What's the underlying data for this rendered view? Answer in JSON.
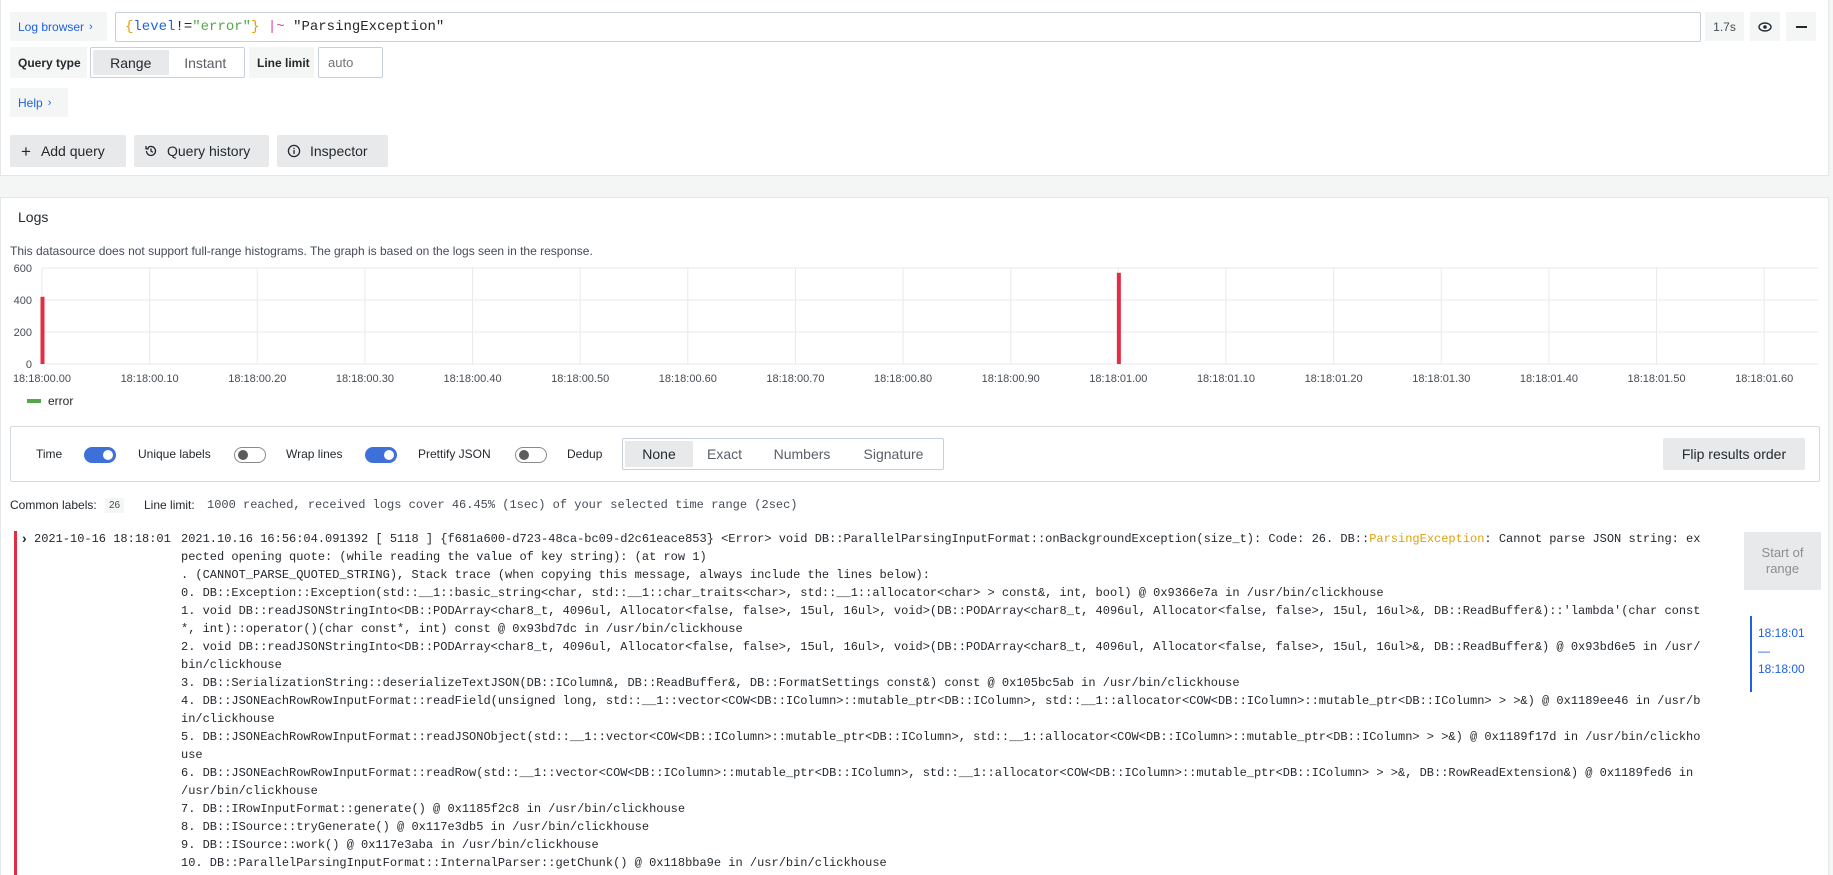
{
  "query_editor": {
    "log_browser_label": "Log browser",
    "query_parts": [
      {
        "text": "{",
        "color": "#e0a106"
      },
      {
        "text": "level",
        "color": "#1f62e0"
      },
      {
        "text": "!=",
        "color": "#24292e"
      },
      {
        "text": "\"error\"",
        "color": "#56a64b"
      },
      {
        "text": "}",
        "color": "#e0a106"
      },
      {
        "text": " |~ ",
        "color": "#d94ba6"
      },
      {
        "text": "\"ParsingException\"",
        "color": "#24292e"
      }
    ],
    "query_time": "1.7s",
    "query_type_label": "Query type",
    "query_type_options": [
      "Range",
      "Instant"
    ],
    "query_type_selected": "Range",
    "line_limit_label": "Line limit",
    "line_limit_placeholder": "auto",
    "help_label": "Help",
    "add_query_label": "Add query",
    "query_history_label": "Query history",
    "inspector_label": "Inspector"
  },
  "logs_panel": {
    "title": "Logs",
    "histogram_note": "This datasource does not support full-range histograms. The graph is based on the logs seen in the response.",
    "legend_series": "error",
    "legend_color": "#56a64b",
    "bar_color": "#e02f44"
  },
  "chart_data": {
    "type": "bar",
    "title": "",
    "xlabel": "",
    "ylabel": "",
    "y_ticks": [
      "600",
      "400",
      "200",
      "0"
    ],
    "ylim": [
      0,
      600
    ],
    "x_ticks": [
      "18:18:00.00",
      "18:18:00.10",
      "18:18:00.20",
      "18:18:00.30",
      "18:18:00.40",
      "18:18:00.50",
      "18:18:00.60",
      "18:18:00.70",
      "18:18:00.80",
      "18:18:00.90",
      "18:18:01.00",
      "18:18:01.10",
      "18:18:01.20",
      "18:18:01.30",
      "18:18:01.40",
      "18:18:01.50",
      "18:18:01.60"
    ],
    "xlim_seconds": [
      0.0,
      1.65
    ],
    "series": [
      {
        "name": "error",
        "points": [
          {
            "x": 0.0,
            "y": 420
          },
          {
            "x": 1.0,
            "y": 570
          }
        ]
      }
    ],
    "grid": true,
    "legend_position": "bottom-left"
  },
  "options_bar": {
    "time_label": "Time",
    "time_on": true,
    "unique_labels_label": "Unique labels",
    "unique_labels_on": false,
    "wrap_lines_label": "Wrap lines",
    "wrap_lines_on": true,
    "prettify_json_label": "Prettify JSON",
    "prettify_json_on": false,
    "dedup_label": "Dedup",
    "dedup_options": [
      "None",
      "Exact",
      "Numbers",
      "Signature"
    ],
    "dedup_selected": "None",
    "flip_label": "Flip results order"
  },
  "meta": {
    "common_labels_label": "Common labels:",
    "common_labels_count": "26",
    "line_limit_label": "Line limit:",
    "line_limit_value": "1000 reached, received logs cover 46.45% (1sec) of your selected time range (2sec)"
  },
  "log_row": {
    "timestamp": "2021-10-16 18:18:01",
    "lines": [
      {
        "text": "2021.10.16 16:56:04.091392 [ 5118 ] {f681a600-d723-48ca-bc09-d2c61eace853} <Error> void DB::ParallelParsingInputFormat::onBackgroundException(size_t): Code: 26. DB::",
        "highlight": "ParsingException",
        "rest": ": Cannot parse JSON string: ex"
      },
      {
        "text": "pected opening quote: (while reading the value of key string): (at row 1)"
      },
      {
        "text": ". (CANNOT_PARSE_QUOTED_STRING), Stack trace (when copying this message, always include the lines below):"
      },
      {
        "text": "0. DB::Exception::Exception(std::__1::basic_string<char, std::__1::char_traits<char>, std::__1::allocator<char> > const&, int, bool) @ 0x9366e7a in /usr/bin/clickhouse"
      },
      {
        "text": "1. void DB::readJSONStringInto<DB::PODArray<char8_t, 4096ul, Allocator<false, false>, 15ul, 16ul>, void>(DB::PODArray<char8_t, 4096ul, Allocator<false, false>, 15ul, 16ul>&, DB::ReadBuffer&)::'lambda'(char const"
      },
      {
        "text": "*, int)::operator()(char const*, int) const @ 0x93bd7dc in /usr/bin/clickhouse"
      },
      {
        "text": "2. void DB::readJSONStringInto<DB::PODArray<char8_t, 4096ul, Allocator<false, false>, 15ul, 16ul>, void>(DB::PODArray<char8_t, 4096ul, Allocator<false, false>, 15ul, 16ul>&, DB::ReadBuffer&) @ 0x93bd6e5 in /usr/"
      },
      {
        "text": "bin/clickhouse"
      },
      {
        "text": "3. DB::SerializationString::deserializeTextJSON(DB::IColumn&, DB::ReadBuffer&, DB::FormatSettings const&) const @ 0x105bc5ab in /usr/bin/clickhouse"
      },
      {
        "text": "4. DB::JSONEachRowRowInputFormat::readField(unsigned long, std::__1::vector<COW<DB::IColumn>::mutable_ptr<DB::IColumn>, std::__1::allocator<COW<DB::IColumn>::mutable_ptr<DB::IColumn> > >&) @ 0x1189ee46 in /usr/b"
      },
      {
        "text": "in/clickhouse"
      },
      {
        "text": "5. DB::JSONEachRowRowInputFormat::readJSONObject(std::__1::vector<COW<DB::IColumn>::mutable_ptr<DB::IColumn>, std::__1::allocator<COW<DB::IColumn>::mutable_ptr<DB::IColumn> > >&) @ 0x1189f17d in /usr/bin/clickho"
      },
      {
        "text": "use"
      },
      {
        "text": "6. DB::JSONEachRowRowInputFormat::readRow(std::__1::vector<COW<DB::IColumn>::mutable_ptr<DB::IColumn>, std::__1::allocator<COW<DB::IColumn>::mutable_ptr<DB::IColumn> > >&, DB::RowReadExtension&) @ 0x1189fed6 in"
      },
      {
        "text": "/usr/bin/clickhouse"
      },
      {
        "text": "7. DB::IRowInputFormat::generate() @ 0x1185f2c8 in /usr/bin/clickhouse"
      },
      {
        "text": "8. DB::ISource::tryGenerate() @ 0x117e3db5 in /usr/bin/clickhouse"
      },
      {
        "text": "9. DB::ISource::work() @ 0x117e3aba in /usr/bin/clickhouse"
      },
      {
        "text": "10. DB::ParallelParsingInputFormat::InternalParser::getChunk() @ 0x118bba9e in /usr/bin/clickhouse"
      }
    ]
  },
  "navigator": {
    "start_label": "Start of range",
    "range_top": "18:18:01",
    "range_dash": "—",
    "range_bottom": "18:18:00"
  },
  "colors": {
    "accent": "#1f62e0",
    "toggle_on": "#3d71d9",
    "highlight": "#e0a106",
    "error_bar": "#e02f44"
  }
}
